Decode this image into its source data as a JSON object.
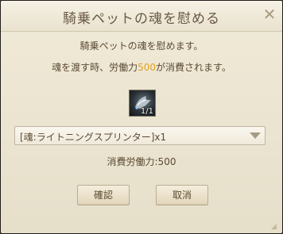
{
  "dialog": {
    "title": "騎乗ペットの魂を慰める",
    "close_symbol": "✕",
    "message_line1": "騎乗ペットの魂を慰めます。",
    "message_line2_prefix": "魂を渡す時、労働力",
    "message_line2_value": "500",
    "message_line2_suffix": "が消費されます。",
    "accent_color": "#e5a21b"
  },
  "item_slot": {
    "icon": "soul-item-icon",
    "count": "1/1"
  },
  "dropdown": {
    "selected_value": "[魂:ライトニングスプリンター]x1"
  },
  "cost_text": "消費労働力:500",
  "buttons": {
    "confirm_label": "確認",
    "cancel_label": "取消"
  }
}
